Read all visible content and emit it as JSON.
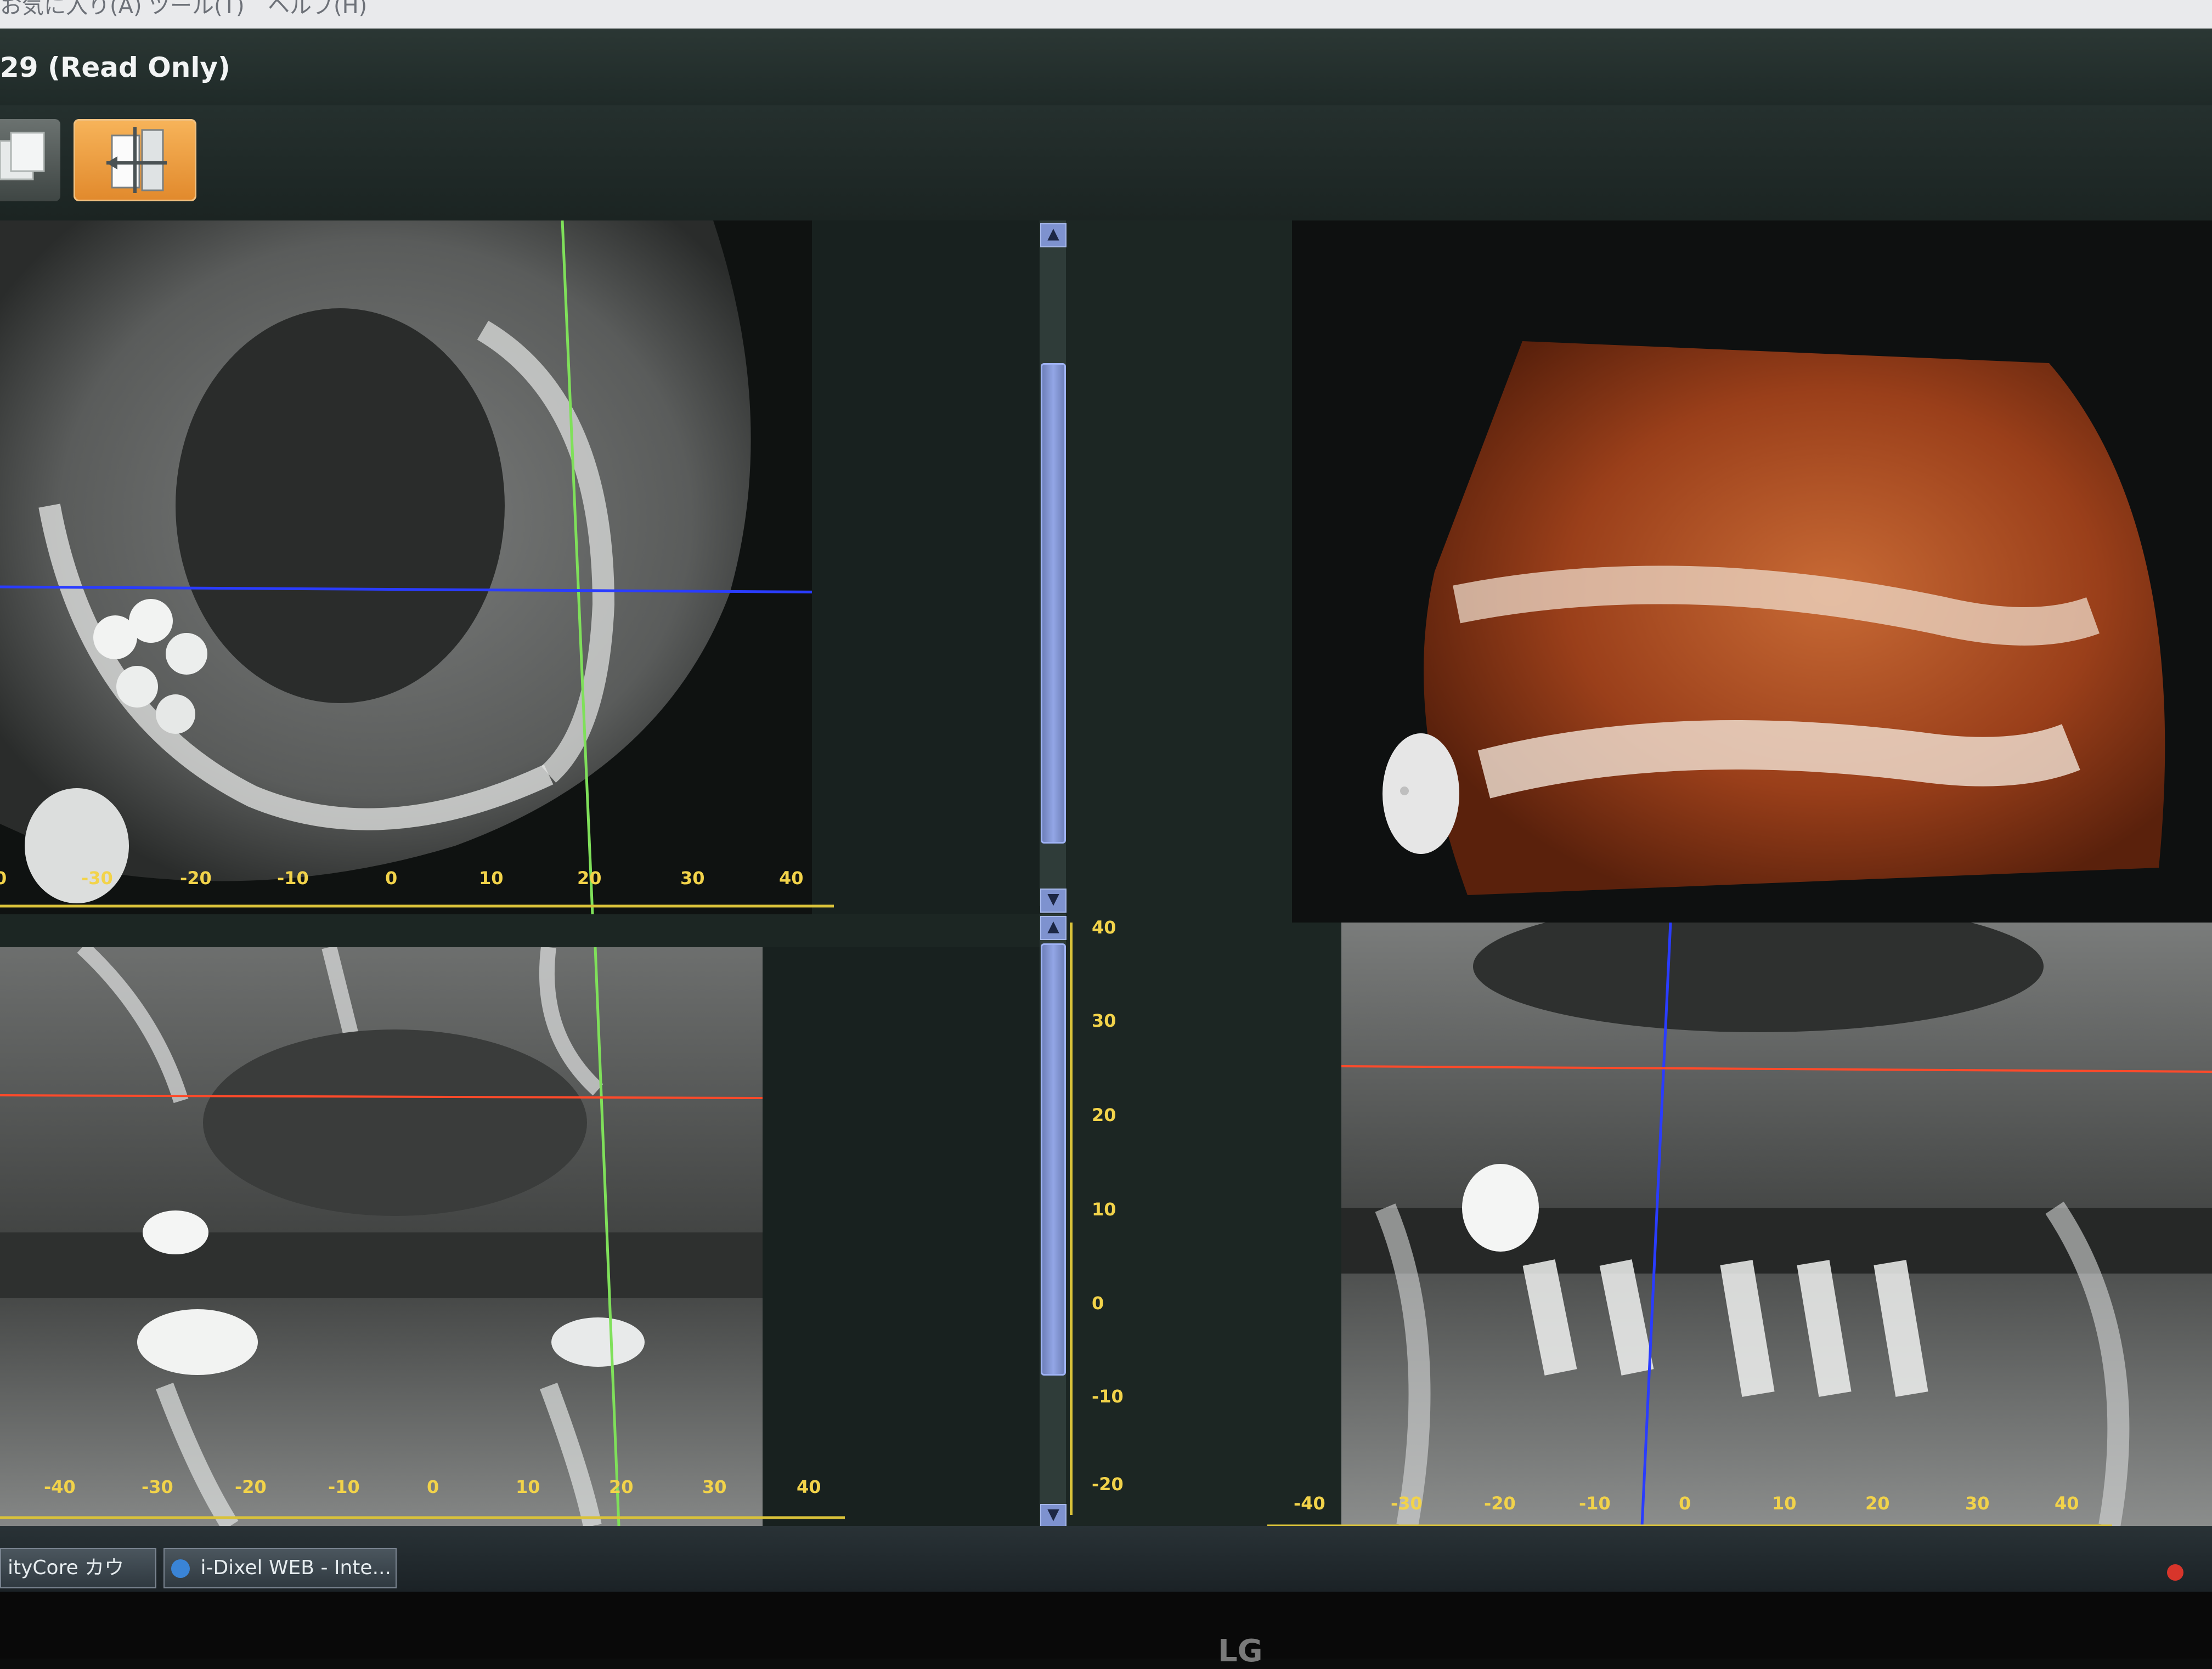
{
  "menubar": {
    "items": [
      "お気に入り(A)",
      "ツール(T)",
      "ヘルプ(H)"
    ]
  },
  "window": {
    "title": "29  (Read Only)"
  },
  "toolbar": {
    "buttons": [
      {
        "name": "layout-button",
        "icon": "stack-icon"
      },
      {
        "name": "mpr-button",
        "icon": "axes-icon",
        "active": true
      }
    ]
  },
  "views": {
    "axial_ruler": [
      "0",
      "-30",
      "-20",
      "-10",
      "0",
      "10",
      "20",
      "30",
      "40"
    ],
    "coronal_ruler": [
      "-40",
      "-30",
      "-20",
      "-10",
      "0",
      "10",
      "20",
      "30",
      "40"
    ],
    "sagittal_ruler": [
      "-40",
      "-30",
      "-20",
      "-10",
      "0",
      "10",
      "20",
      "30",
      "40"
    ],
    "vertical_ruler": [
      "40",
      "30",
      "20",
      "10",
      "0",
      "-10",
      "-20"
    ]
  },
  "taskbar": {
    "tasks": [
      "ityCore カウン...",
      "i-Dixel WEB - Inte..."
    ]
  },
  "monitor": {
    "brand": "LG"
  },
  "colors": {
    "accent_orange": "#ee9f40",
    "crosshair_green": "#7fe05a",
    "crosshair_blue": "#2a3cff",
    "crosshair_red": "#ff4a2a",
    "scroll_blue": "#8ea2df"
  }
}
